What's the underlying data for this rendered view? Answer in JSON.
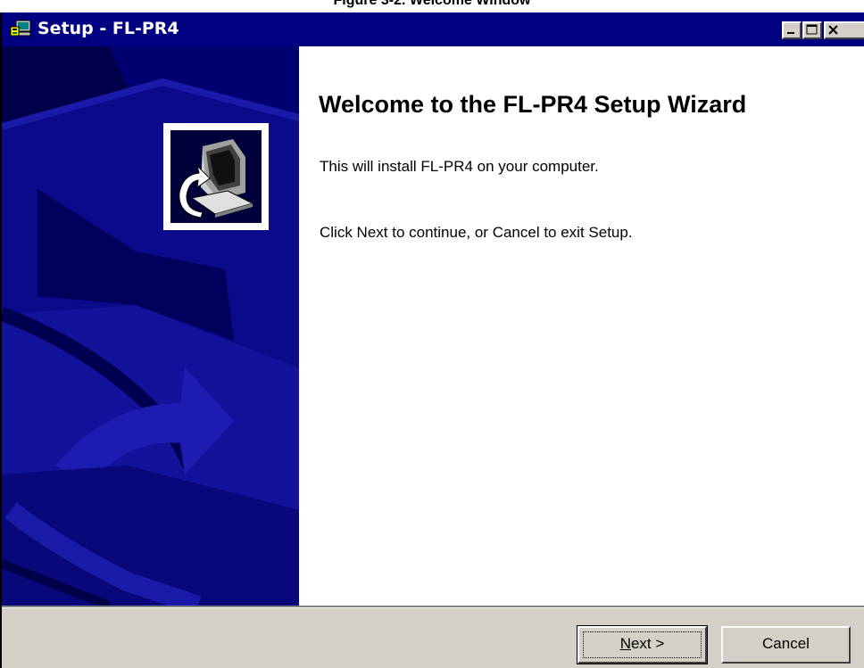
{
  "caption": "Figure 3-2. Welcome Window",
  "window": {
    "title": "Setup - FL-PR4",
    "title_icon": "setup-computer-icon",
    "controls": [
      "minimize-icon",
      "maximize-icon",
      "close-icon"
    ]
  },
  "content": {
    "heading": "Welcome to the FL-PR4 Setup Wizard",
    "line1": "This will install FL-PR4 on your computer.",
    "line2": "Click Next to continue, or Cancel to exit Setup."
  },
  "buttons": {
    "next_label": "Next >",
    "cancel_label": "Cancel"
  },
  "colors": {
    "title_bar": "#000080",
    "side_panel": "#000050",
    "dialog_face": "#d4d0c8"
  }
}
